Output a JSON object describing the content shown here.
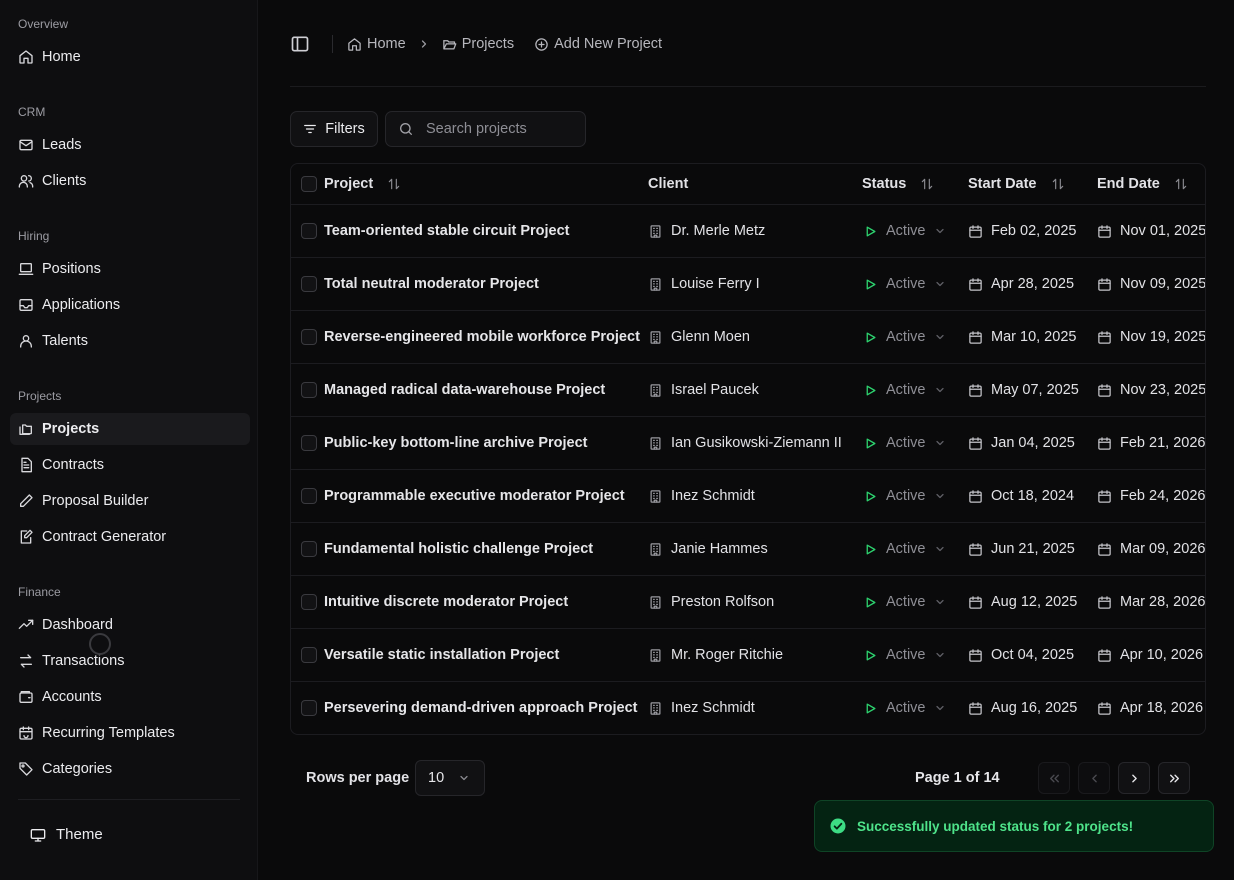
{
  "sidebar": {
    "sections": [
      {
        "title": "Overview",
        "items": [
          {
            "label": "Home",
            "icon": "home-icon"
          }
        ]
      },
      {
        "title": "CRM",
        "items": [
          {
            "label": "Leads",
            "icon": "mail-icon"
          },
          {
            "label": "Clients",
            "icon": "users-icon"
          }
        ]
      },
      {
        "title": "Hiring",
        "items": [
          {
            "label": "Positions",
            "icon": "laptop-icon"
          },
          {
            "label": "Applications",
            "icon": "inbox-icon"
          },
          {
            "label": "Talents",
            "icon": "user-icon"
          }
        ]
      },
      {
        "title": "Projects",
        "items": [
          {
            "label": "Projects",
            "icon": "folders-icon",
            "active": true
          },
          {
            "label": "Contracts",
            "icon": "file-text-icon"
          },
          {
            "label": "Proposal Builder",
            "icon": "pen-icon"
          },
          {
            "label": "Contract Generator",
            "icon": "file-edit-icon"
          }
        ]
      },
      {
        "title": "Finance",
        "items": [
          {
            "label": "Dashboard",
            "icon": "trending-up-icon"
          },
          {
            "label": "Transactions",
            "icon": "swap-icon"
          },
          {
            "label": "Accounts",
            "icon": "wallet-icon"
          },
          {
            "label": "Recurring Templates",
            "icon": "calendar-repeat-icon"
          },
          {
            "label": "Categories",
            "icon": "tag-icon"
          }
        ]
      }
    ],
    "theme_label": "Theme"
  },
  "breadcrumb": {
    "home": "Home",
    "projects": "Projects",
    "add": "Add New Project"
  },
  "toolbar": {
    "filters_label": "Filters",
    "search_placeholder": "Search projects"
  },
  "table": {
    "columns": [
      "Project",
      "Client",
      "Status",
      "Start Date",
      "End Date"
    ],
    "rows": [
      {
        "project": "Team-oriented stable circuit Project",
        "client": "Dr. Merle Metz",
        "status": "Active",
        "start": "Feb 02, 2025",
        "end": "Nov 01, 2025"
      },
      {
        "project": "Total neutral moderator Project",
        "client": "Louise Ferry I",
        "status": "Active",
        "start": "Apr 28, 2025",
        "end": "Nov 09, 2025"
      },
      {
        "project": "Reverse-engineered mobile workforce Project",
        "client": "Glenn Moen",
        "status": "Active",
        "start": "Mar 10, 2025",
        "end": "Nov 19, 2025"
      },
      {
        "project": "Managed radical data-warehouse Project",
        "client": "Israel Paucek",
        "status": "Active",
        "start": "May 07, 2025",
        "end": "Nov 23, 2025"
      },
      {
        "project": "Public-key bottom-line archive Project",
        "client": "Ian Gusikowski-Ziemann II",
        "status": "Active",
        "start": "Jan 04, 2025",
        "end": "Feb 21, 2026"
      },
      {
        "project": "Programmable executive moderator Project",
        "client": "Inez Schmidt",
        "status": "Active",
        "start": "Oct 18, 2024",
        "end": "Feb 24, 2026"
      },
      {
        "project": "Fundamental holistic challenge Project",
        "client": "Janie Hammes",
        "status": "Active",
        "start": "Jun 21, 2025",
        "end": "Mar 09, 2026"
      },
      {
        "project": "Intuitive discrete moderator Project",
        "client": "Preston Rolfson",
        "status": "Active",
        "start": "Aug 12, 2025",
        "end": "Mar 28, 2026"
      },
      {
        "project": "Versatile static installation Project",
        "client": "Mr. Roger Ritchie",
        "status": "Active",
        "start": "Oct 04, 2025",
        "end": "Apr 10, 2026"
      },
      {
        "project": "Persevering demand-driven approach Project",
        "client": "Inez Schmidt",
        "status": "Active",
        "start": "Aug 16, 2025",
        "end": "Apr 18, 2026"
      }
    ]
  },
  "pagination": {
    "rows_per_page_label": "Rows per page",
    "rows_per_page_value": "10",
    "page_text": "Page 1 of 14"
  },
  "toast": {
    "message": "Successfully updated status for 2 projects!"
  },
  "colors": {
    "accent_green": "#2dd36f",
    "toast_bg": "#042312",
    "background": "#0a0a0b"
  }
}
